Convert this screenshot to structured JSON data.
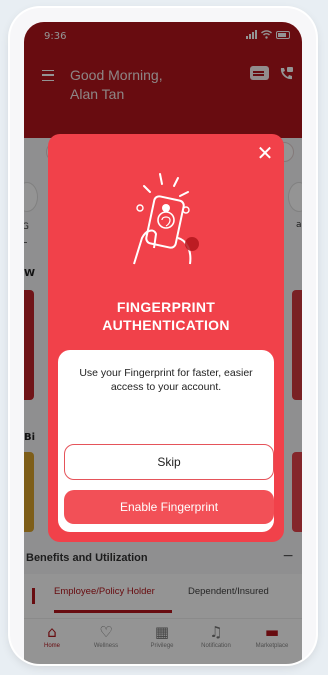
{
  "status_bar": {
    "time": "9:36"
  },
  "header": {
    "greeting_line1": "Good Morning,",
    "greeting_line2": "Alan Tan"
  },
  "background": {
    "left_label_1": "G",
    "left_label_2": "L",
    "right_label": "al",
    "section_w": "W",
    "section_b": "Bi"
  },
  "benefits": {
    "title": "Benefits and Utilization",
    "collapse": "−",
    "tabs": [
      {
        "label": "Employee/Policy Holder"
      },
      {
        "label": "Dependent/Insured"
      }
    ]
  },
  "bottom_nav": {
    "items": [
      {
        "label": "Home",
        "icon": "home-icon"
      },
      {
        "label": "Wellness",
        "icon": "wellness-icon"
      },
      {
        "label": "Privilege",
        "icon": "privilege-icon"
      },
      {
        "label": "Notification",
        "icon": "bell-icon"
      },
      {
        "label": "Marketplace",
        "icon": "marketplace-icon"
      }
    ]
  },
  "modal": {
    "title_line1": "FINGERPRINT",
    "title_line2": "AUTHENTICATION",
    "message": "Use your Fingerprint for faster, easier access to your account.",
    "skip_label": "Skip",
    "enable_label": "Enable Fingerprint",
    "close_glyph": "✕"
  },
  "colors": {
    "brand_red": "#b3161c",
    "modal_red": "#f1414a",
    "button_red": "#f25057"
  }
}
